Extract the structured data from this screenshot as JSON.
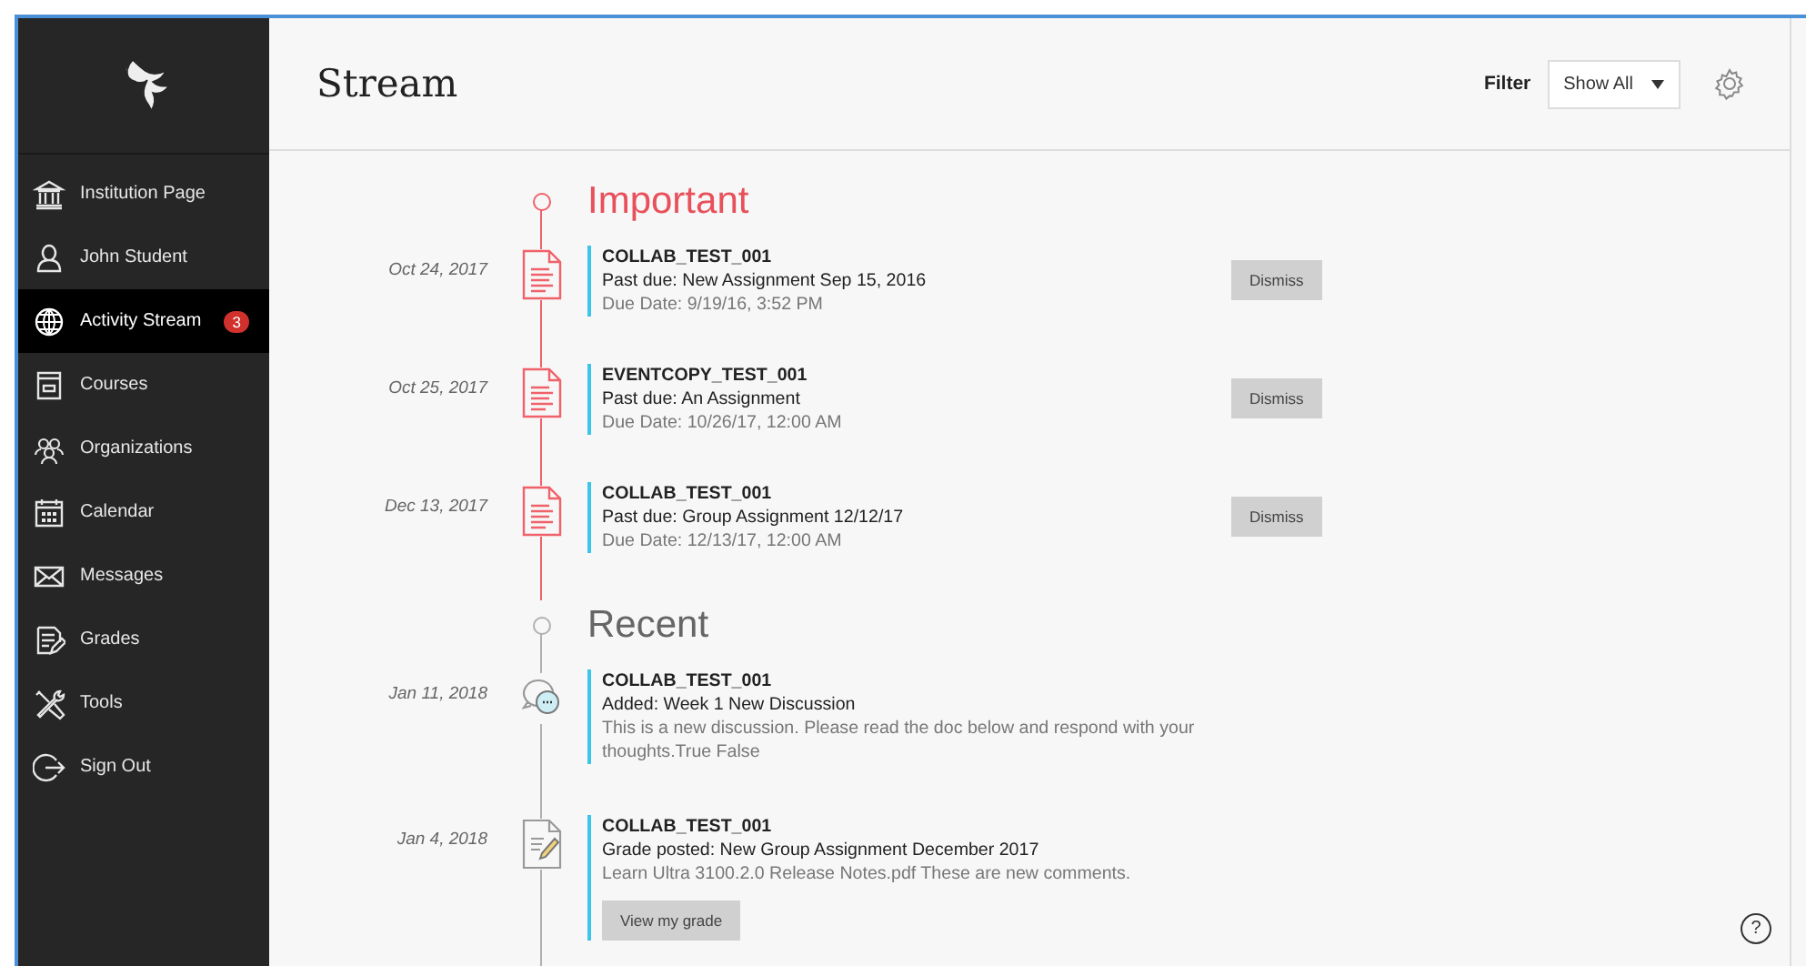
{
  "sidebar": {
    "items": [
      {
        "label": "Institution Page",
        "selected": false
      },
      {
        "label": "John Student",
        "selected": false
      },
      {
        "label": "Activity Stream",
        "selected": true,
        "badge": "3"
      },
      {
        "label": "Courses",
        "selected": false
      },
      {
        "label": "Organizations",
        "selected": false
      },
      {
        "label": "Calendar",
        "selected": false
      },
      {
        "label": "Messages",
        "selected": false
      },
      {
        "label": "Grades",
        "selected": false
      },
      {
        "label": "Tools",
        "selected": false
      },
      {
        "label": "Sign Out",
        "selected": false
      }
    ]
  },
  "header": {
    "title": "Stream",
    "filter_label": "Filter",
    "filter_value": "Show All"
  },
  "sections": [
    {
      "title": "Important",
      "kind": "important",
      "entries": [
        {
          "kind": "assignment",
          "date": "Oct 24, 2017",
          "course": "COLLAB_TEST_001",
          "title": "Past due: New Assignment Sep 15, 2016",
          "detail": "Due Date: 9/19/16, 3:52 PM",
          "action": "Dismiss"
        },
        {
          "kind": "assignment",
          "date": "Oct 25, 2017",
          "course": "EVENTCOPY_TEST_001",
          "title": "Past due: An Assignment",
          "detail": "Due Date: 10/26/17, 12:00 AM",
          "action": "Dismiss"
        },
        {
          "kind": "assignment",
          "date": "Dec 13, 2017",
          "course": "COLLAB_TEST_001",
          "title": "Past due: Group Assignment 12/12/17",
          "detail": "Due Date: 12/13/17, 12:00 AM",
          "action": "Dismiss"
        }
      ]
    },
    {
      "title": "Recent",
      "kind": "recent",
      "entries": [
        {
          "kind": "discussion",
          "date": "Jan 11, 2018",
          "course": "COLLAB_TEST_001",
          "title": "Added: Week 1 New Discussion",
          "detail": "This is a new discussion. Please read the doc below and respond with your thoughts.True False"
        },
        {
          "kind": "grade",
          "date": "Jan 4, 2018",
          "course": "COLLAB_TEST_001",
          "title": "Grade posted: New Group Assignment December 2017",
          "detail": "Learn Ultra 3100.2.0 Release Notes.pdf These are new comments.",
          "link_button": "View my grade"
        }
      ]
    }
  ],
  "help": {
    "label": "?"
  }
}
